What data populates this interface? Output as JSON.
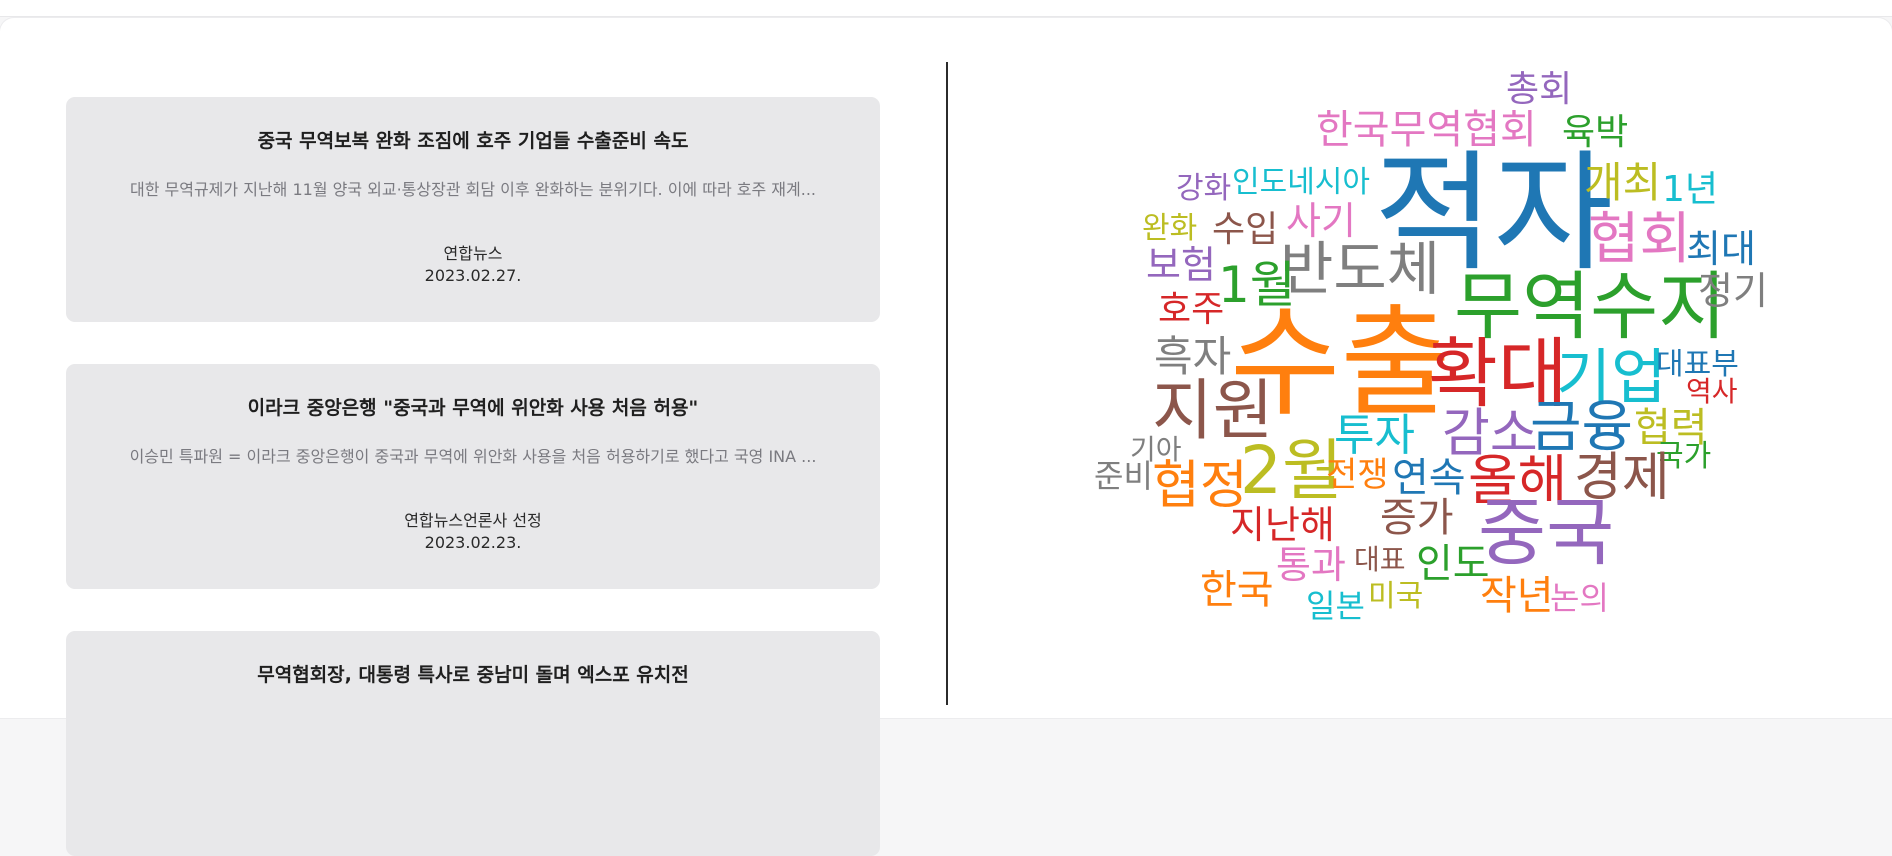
{
  "news": [
    {
      "title": "중국 무역보복 완화 조짐에 호주 기업들 수출준비 속도",
      "summary": "대한 무역규제가 지난해 11월 양국 외교·통상장관 회담 이후 완화하는 분위기다. 이에 따라 호주 재계...",
      "source": "연합뉴스",
      "date": "2023.02.27."
    },
    {
      "title": "이라크 중앙은행 \"중국과 무역에 위안화 사용 처음 허용\"",
      "summary": "이승민 특파원 = 이라크 중앙은행이 중국과 무역에 위안화 사용을 처음 허용하기로 했다고 국영 INA ...",
      "source": "연합뉴스언론사 선정",
      "date": "2023.02.23."
    },
    {
      "title": "무역협회장, 대통령 특사로 중남미 돌며 엑스포 유치전",
      "summary": "",
      "source": "",
      "date": ""
    }
  ],
  "wordcloud": {
    "words": [
      {
        "text": "총회",
        "color": "#9467bd"
      },
      {
        "text": "한국무역협회",
        "color": "#e377c2"
      },
      {
        "text": "육박",
        "color": "#2ca02c"
      },
      {
        "text": "적자",
        "color": "#1f77b4"
      },
      {
        "text": "개최",
        "color": "#bcbd22"
      },
      {
        "text": "1년",
        "color": "#17becf"
      },
      {
        "text": "강화",
        "color": "#9467bd"
      },
      {
        "text": "인도네시아",
        "color": "#17becf"
      },
      {
        "text": "협회",
        "color": "#e377c2"
      },
      {
        "text": "최대",
        "color": "#1f77b4"
      },
      {
        "text": "완화",
        "color": "#bcbd22"
      },
      {
        "text": "수입",
        "color": "#8c564b"
      },
      {
        "text": "사기",
        "color": "#e377c2"
      },
      {
        "text": "보험",
        "color": "#9467bd"
      },
      {
        "text": "반도체",
        "color": "#7f7f7f"
      },
      {
        "text": "무역수지",
        "color": "#2ca02c"
      },
      {
        "text": "정기",
        "color": "#7f7f7f"
      },
      {
        "text": "1월",
        "color": "#2ca02c"
      },
      {
        "text": "호주",
        "color": "#d62728"
      },
      {
        "text": "수출",
        "color": "#ff7f0e"
      },
      {
        "text": "흑자",
        "color": "#7f7f7f"
      },
      {
        "text": "확대",
        "color": "#d62728"
      },
      {
        "text": "기업",
        "color": "#17becf"
      },
      {
        "text": "대표부",
        "color": "#1f77b4"
      },
      {
        "text": "역사",
        "color": "#d62728"
      },
      {
        "text": "지원",
        "color": "#8c564b"
      },
      {
        "text": "투자",
        "color": "#17becf"
      },
      {
        "text": "감소",
        "color": "#9467bd"
      },
      {
        "text": "금융",
        "color": "#1f77b4"
      },
      {
        "text": "협력",
        "color": "#bcbd22"
      },
      {
        "text": "기아",
        "color": "#7f7f7f"
      },
      {
        "text": "2월",
        "color": "#bcbd22"
      },
      {
        "text": "국가",
        "color": "#2ca02c"
      },
      {
        "text": "준비",
        "color": "#7f7f7f"
      },
      {
        "text": "협정",
        "color": "#ff7f0e"
      },
      {
        "text": "전쟁",
        "color": "#ff7f0e"
      },
      {
        "text": "연속",
        "color": "#1f77b4"
      },
      {
        "text": "올해",
        "color": "#d62728"
      },
      {
        "text": "경제",
        "color": "#8c564b"
      },
      {
        "text": "증가",
        "color": "#8c564b"
      },
      {
        "text": "지난해",
        "color": "#d62728"
      },
      {
        "text": "중국",
        "color": "#9467bd"
      },
      {
        "text": "통과",
        "color": "#e377c2"
      },
      {
        "text": "대표",
        "color": "#8c564b"
      },
      {
        "text": "인도",
        "color": "#2ca02c"
      },
      {
        "text": "한국",
        "color": "#ff7f0e"
      },
      {
        "text": "작년",
        "color": "#ff7f0e"
      },
      {
        "text": "일본",
        "color": "#17becf"
      },
      {
        "text": "미국",
        "color": "#bcbd22"
      },
      {
        "text": "논의",
        "color": "#e377c2"
      }
    ]
  }
}
